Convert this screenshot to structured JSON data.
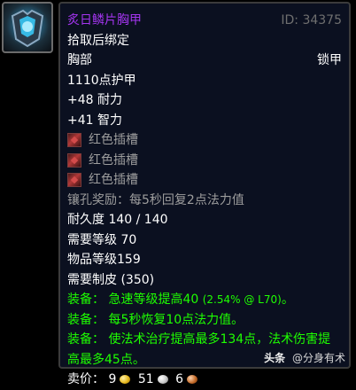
{
  "item": {
    "icon": "chest-armor-icon",
    "name": "炙日鳞片胸甲",
    "id_label": "ID: 34375",
    "bind": "拾取后绑定",
    "slot": "胸部",
    "armor_type": "锁甲",
    "armor": "1110点护甲",
    "stats": [
      "+48 耐力",
      "+41 智力"
    ],
    "sockets": [
      "红色插槽",
      "红色插槽",
      "红色插槽"
    ],
    "socket_bonus": "镶孔奖励：每5秒回复2点法力值",
    "durability": "耐久度 140 / 140",
    "req_level": "需要等级 70",
    "item_level": "物品等级159",
    "req_skill": "需要制皮 (350)",
    "equip_effects": [
      {
        "prefix": "装备：",
        "text": "急速等级提高40",
        "detail": "(2.54% @ L70)",
        "suffix": "。"
      },
      {
        "prefix": "装备：",
        "text": "每5秒恢复10点法力值。"
      },
      {
        "prefix": "装备：",
        "text": "使法术治疗提高最多134点，法术伤害提高最多45点。"
      }
    ],
    "sell_price": {
      "label": "卖价：",
      "gold": "9",
      "silver": "51",
      "copper": "6"
    }
  },
  "colors": {
    "name": "#a335ee",
    "equip": "#1eff00",
    "gray": "#9d9d9d",
    "id": "#6f6f6f",
    "socket_red": "#b13838"
  },
  "watermark": {
    "brand": "头条",
    "text": "@分身有术"
  }
}
